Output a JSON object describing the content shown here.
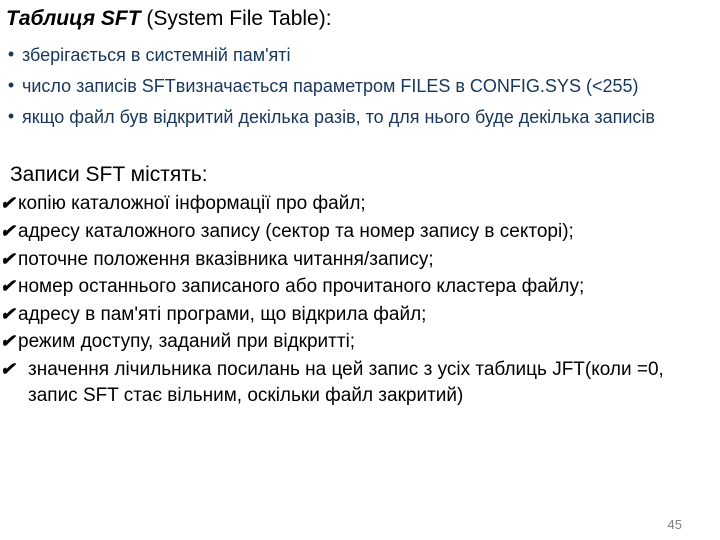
{
  "title": {
    "prefix": "Таблиця SFT",
    "suffix": " (System File Table):"
  },
  "darkList": [
    "зберігається в системній пам'яті",
    "число записів SFTвизначається параметром FILES в CONFIG.SYS (<255)",
    "якщо файл був відкритий декілька разів, то для нього буде декілька записів"
  ],
  "subTitle": "Записи SFT містять:",
  "checks": [
    "копію каталожної інформації про файл;",
    "адресу каталожного запису (сектор та номер запису в секторі);",
    "поточне положення вказівника читання/запису;",
    "номер останнього записаного або прочитаного кластера файлу;",
    "адресу в пам'яті програми, що відкрила файл;",
    "режим доступу, заданий при відкритті;",
    " значення лічильника посилань на цей запис з усіх таблиць JFT(коли =0, запис SFT стає вільним, оскільки файл закритий)"
  ],
  "pageNumber": "45",
  "bullets": {
    "dot": "•",
    "check": "✔"
  }
}
